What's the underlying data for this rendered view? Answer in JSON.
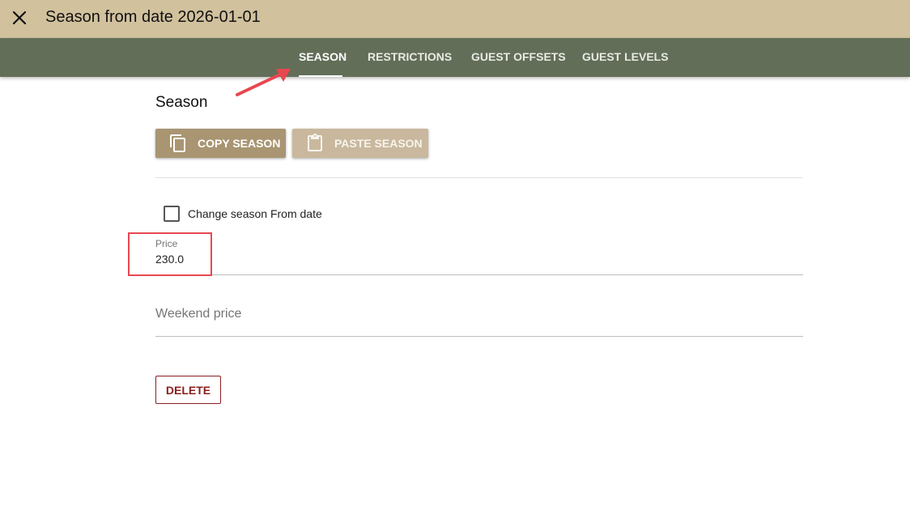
{
  "dialog": {
    "title": "Season from date 2026-01-01"
  },
  "tabs": [
    {
      "label": "SEASON",
      "active": true
    },
    {
      "label": "RESTRICTIONS",
      "active": false
    },
    {
      "label": "GUEST OFFSETS",
      "active": false
    },
    {
      "label": "GUEST LEVELS",
      "active": false
    }
  ],
  "section": {
    "title": "Season"
  },
  "toolbar": {
    "copy_label": "COPY SEASON",
    "copy_icon": "copy-icon",
    "paste_label": "PASTE SEASON",
    "paste_icon": "clipboard-icon"
  },
  "checkbox": {
    "label": "Change season From date",
    "checked": false
  },
  "fields": {
    "price": {
      "label": "Price",
      "value": "230.0"
    },
    "weekend_price": {
      "placeholder": "Weekend price",
      "value": ""
    }
  },
  "actions": {
    "delete_label": "DELETE"
  },
  "colors": {
    "titlebar": "#d1c19d",
    "tabbar": "#636e58",
    "copy_button": "#a99572",
    "paste_button": "#c9b89d",
    "delete": "#8b1f1f",
    "annotation": "#e8474f"
  }
}
